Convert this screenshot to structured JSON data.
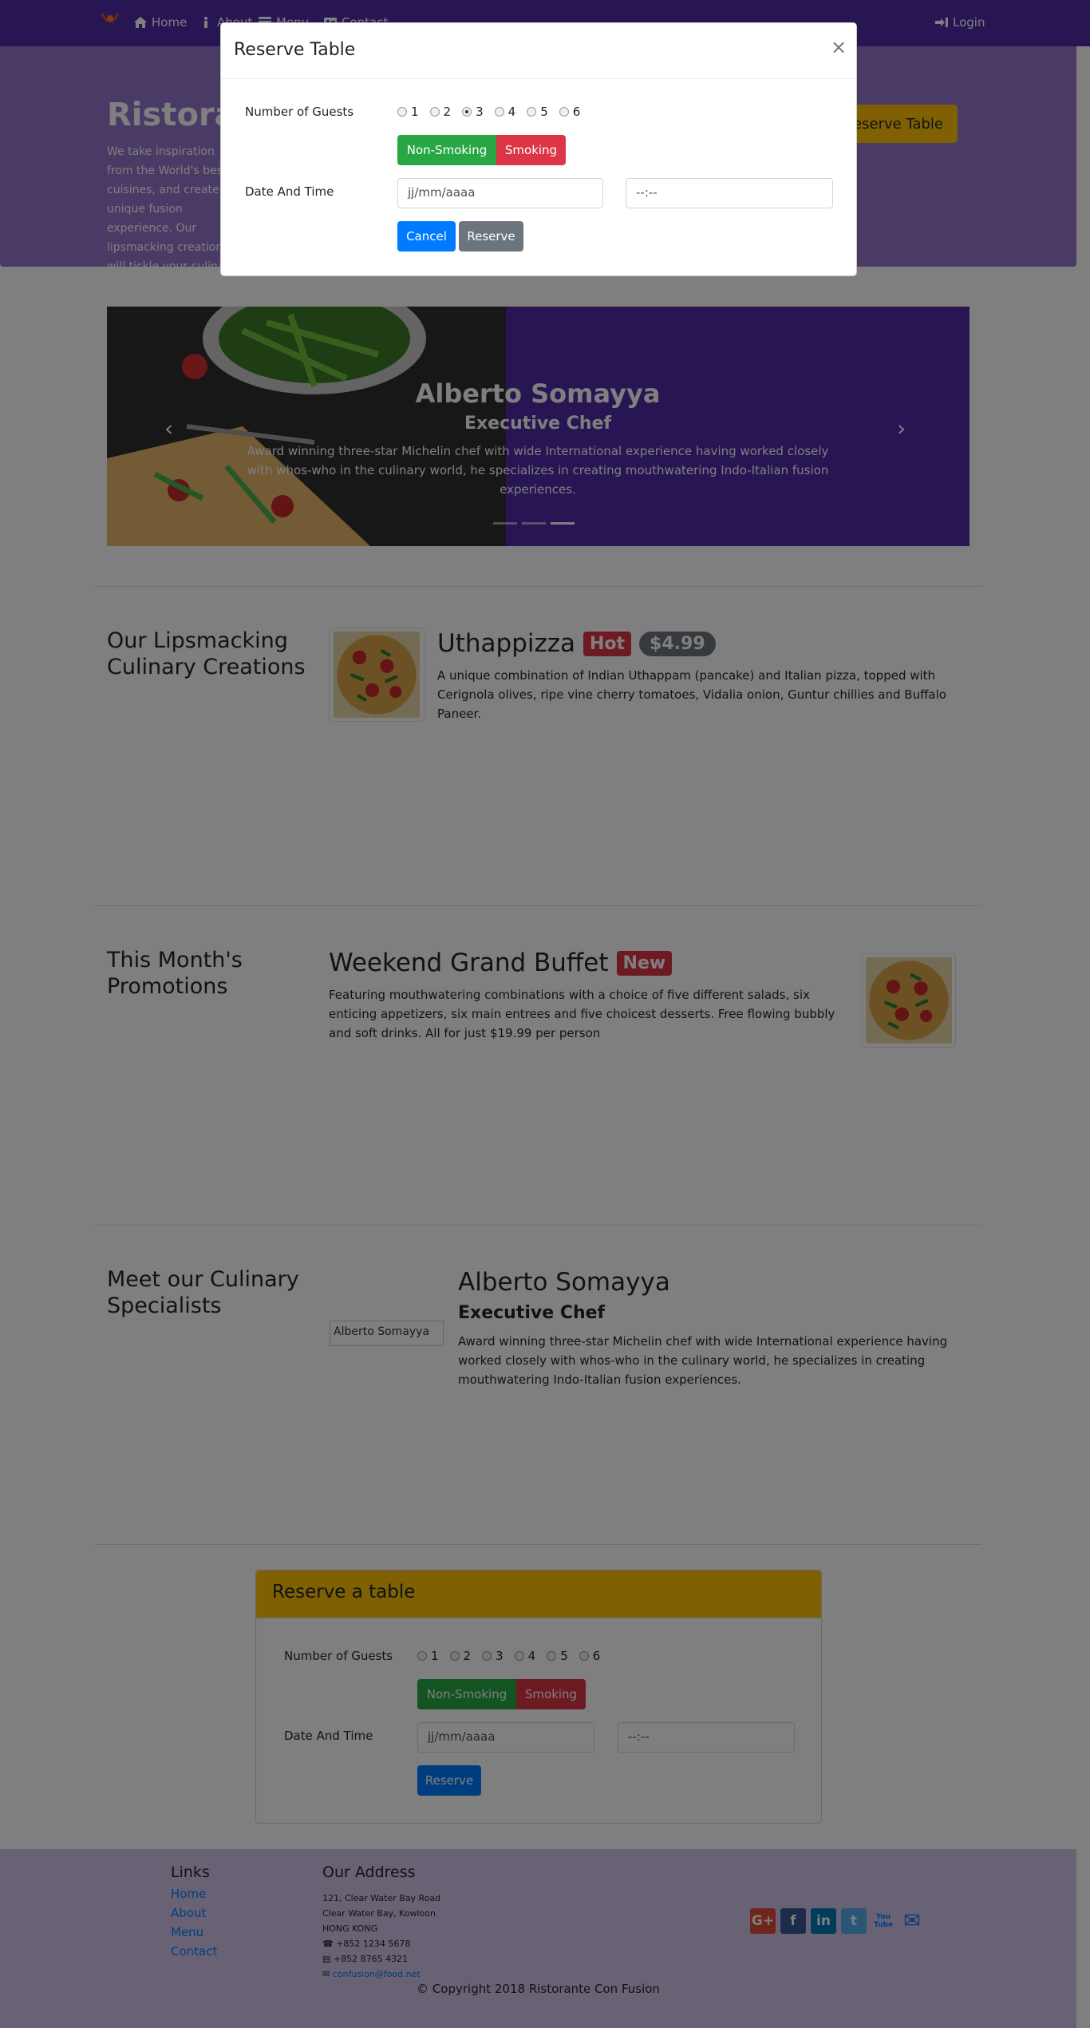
{
  "nav": {
    "items": [
      {
        "label": "Home",
        "icon": "home-icon"
      },
      {
        "label": "About",
        "icon": "info-icon"
      },
      {
        "label": "Menu",
        "icon": "list-icon"
      },
      {
        "label": "Contact",
        "icon": "address-card-icon"
      }
    ],
    "login": "Login"
  },
  "jumbotron": {
    "title": "Ristorante Con Fusion",
    "text": "We take inspiration from the World's best cuisines, and create a unique fusion experience. Our lipsmacking creations will tickle your culinary senses!",
    "reserve_button": "Reserve Table"
  },
  "carousel": {
    "name": "Alberto Somayya",
    "title": "Executive Chef",
    "text": "Award winning three-star Michelin chef with wide International experience having worked closely with whos-who in the culinary world, he specializes in creating mouthwatering Indo-Italian fusion experiences.",
    "prev": "‹",
    "next": "›"
  },
  "dish": {
    "heading": "Our Lipsmacking Culinary Creations",
    "name": "Uthappizza",
    "badge": "Hot",
    "price": "$4.99",
    "text": "A unique combination of Indian Uthappam (pancake) and Italian pizza, topped with Cerignola olives, ripe vine cherry tomatoes, Vidalia onion, Guntur chillies and Buffalo Paneer."
  },
  "promotion": {
    "heading": "This Month's Promotions",
    "name": "Weekend Grand Buffet",
    "badge": "New",
    "text": "Featuring mouthwatering combinations with a choice of five different salads, six enticing appetizers, six main entrees and five choicest desserts. Free flowing bubbly and soft drinks. All for just $19.99 per person"
  },
  "leader": {
    "heading": "Meet our Culinary Specialists",
    "img_alt": "Alberto Somayya",
    "name": "Alberto Somayya",
    "title": "Executive Chef",
    "text": "Award winning three-star Michelin chef with wide International experience having worked closely with whos-who in the culinary world, he specializes in creating mouthwatering Indo-Italian fusion experiences."
  },
  "reserve_card": {
    "title": "Reserve a table",
    "guests_label": "Number of Guests",
    "guests": [
      "1",
      "2",
      "3",
      "4",
      "5",
      "6"
    ],
    "non_smoking": "Non-Smoking",
    "smoking": "Smoking",
    "datetime_label": "Date And Time",
    "date_placeholder": "jj/mm/aaaa",
    "time_placeholder": "--:--",
    "reserve": "Reserve"
  },
  "footer": {
    "links_heading": "Links",
    "links": [
      "Home",
      "About",
      "Menu",
      "Contact"
    ],
    "address_heading": "Our Address",
    "address": [
      "121, Clear Water Bay Road",
      "Clear Water Bay, Kowloon",
      "HONG KONG"
    ],
    "phone": "+852 1234 5678",
    "fax": "+852 8765 4321",
    "email": "confusion@food.net",
    "social": [
      {
        "label": "G+",
        "icon": "google-plus-icon",
        "color": "#dd4b39"
      },
      {
        "label": "f",
        "icon": "facebook-icon",
        "color": "#3b5998"
      },
      {
        "label": "in",
        "icon": "linkedin-icon",
        "color": "#007bb6"
      },
      {
        "label": "t",
        "icon": "twitter-icon",
        "color": "#55acee"
      },
      {
        "label": "You Tube",
        "icon": "youtube-icon",
        "color": "#bb0000"
      },
      {
        "label": "✉",
        "icon": "envelope-icon",
        "color": "#007bff"
      }
    ],
    "copyright": "© Copyright 2018 Ristorante Con Fusion"
  },
  "modal": {
    "title": "Reserve Table",
    "close": "×",
    "guests_label": "Number of Guests",
    "guests": [
      "1",
      "2",
      "3",
      "4",
      "5",
      "6"
    ],
    "selected_guests": "3",
    "non_smoking": "Non-Smoking",
    "smoking": "Smoking",
    "datetime_label": "Date And Time",
    "date_placeholder": "jj/mm/aaaa",
    "time_placeholder": "--:--",
    "cancel": "Cancel",
    "reserve": "Reserve"
  },
  "colors": {
    "primary": "#512da8",
    "light": "#9575cd",
    "accent": "#ffc107",
    "footer": "#d1c4e9"
  }
}
